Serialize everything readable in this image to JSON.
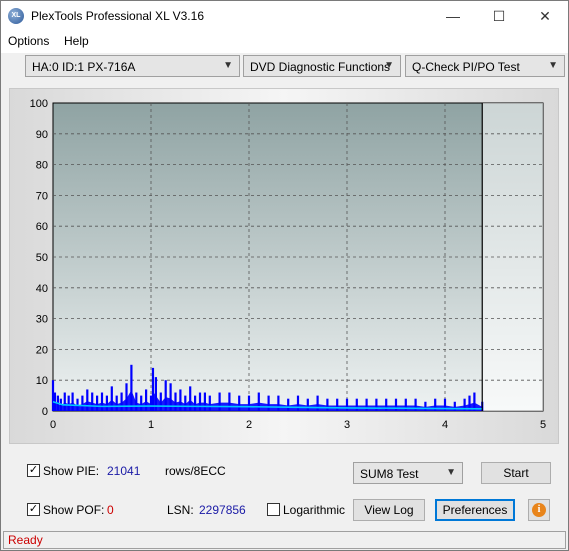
{
  "window": {
    "title": "PlexTools Professional XL V3.16",
    "icon": "XL"
  },
  "window_controls": {
    "minimize": "—",
    "maximize": "☐",
    "close": "✕"
  },
  "menu": [
    "Options",
    "Help"
  ],
  "toolbar": {
    "drive": "HA:0 ID:1  PX-716A",
    "function": "DVD Diagnostic Functions",
    "test": "Q-Check PI/PO Test"
  },
  "chart_data": {
    "type": "area",
    "title": "",
    "xlabel": "",
    "ylabel": "",
    "x_ticks": [
      "0",
      "1",
      "2",
      "3",
      "4",
      "5"
    ],
    "y_ticks": [
      "0",
      "10",
      "20",
      "30",
      "40",
      "50",
      "60",
      "70",
      "80",
      "90",
      "100"
    ],
    "xlim": [
      0,
      5
    ],
    "ylim": [
      0,
      100
    ],
    "grid": true,
    "end_marker_x": 4.38,
    "series": [
      {
        "color": "#0000ff",
        "x": [
          0.0,
          0.02,
          0.05,
          0.08,
          0.12,
          0.16,
          0.2,
          0.25,
          0.3,
          0.35,
          0.4,
          0.45,
          0.5,
          0.55,
          0.6,
          0.65,
          0.7,
          0.75,
          0.8,
          0.85,
          0.9,
          0.95,
          1.0,
          1.02,
          1.05,
          1.1,
          1.15,
          1.2,
          1.25,
          1.3,
          1.35,
          1.4,
          1.45,
          1.5,
          1.55,
          1.6,
          1.7,
          1.8,
          1.9,
          2.0,
          2.1,
          2.2,
          2.3,
          2.4,
          2.5,
          2.6,
          2.7,
          2.8,
          2.9,
          3.0,
          3.1,
          3.2,
          3.3,
          3.4,
          3.5,
          3.6,
          3.7,
          3.8,
          3.9,
          4.0,
          4.1,
          4.2,
          4.25,
          4.3,
          4.38
        ],
        "values": [
          10,
          6,
          5,
          4,
          6,
          5,
          6,
          4,
          5,
          7,
          6,
          5,
          6,
          5,
          8,
          5,
          6,
          9,
          15,
          6,
          5,
          7,
          5,
          14,
          11,
          6,
          10,
          9,
          6,
          7,
          5,
          8,
          5,
          6,
          6,
          5,
          6,
          6,
          5,
          5,
          6,
          5,
          5,
          4,
          5,
          4,
          5,
          4,
          4,
          4,
          4,
          4,
          4,
          4,
          4,
          4,
          4,
          3,
          4,
          4,
          3,
          4,
          5,
          6,
          3
        ]
      },
      {
        "color": "#00c8ff",
        "x": [
          0.0,
          0.1,
          0.5,
          1.0,
          1.5,
          2.0,
          2.5,
          3.0,
          3.5,
          4.0,
          4.38
        ],
        "values": [
          3,
          2,
          1.5,
          1.6,
          1.5,
          1.4,
          1.2,
          1.0,
          0.9,
          0.8,
          0.7
        ]
      }
    ]
  },
  "controls": {
    "show_pie_label": "Show PIE:",
    "show_pie_checked": "✓",
    "pie_value": "21041",
    "pie_unit": "rows/8ECC",
    "show_pof_label": "Show POF:",
    "show_pof_checked": "✓",
    "pof_value": "0",
    "lsn_label": "LSN:",
    "lsn_value": "2297856",
    "log_label": "Logarithmic",
    "sum_select": "SUM8 Test",
    "start_button": "Start",
    "view_log_button": "View Log",
    "preferences_button": "Preferences",
    "info_icon": "i"
  },
  "status": {
    "text": "Ready"
  }
}
